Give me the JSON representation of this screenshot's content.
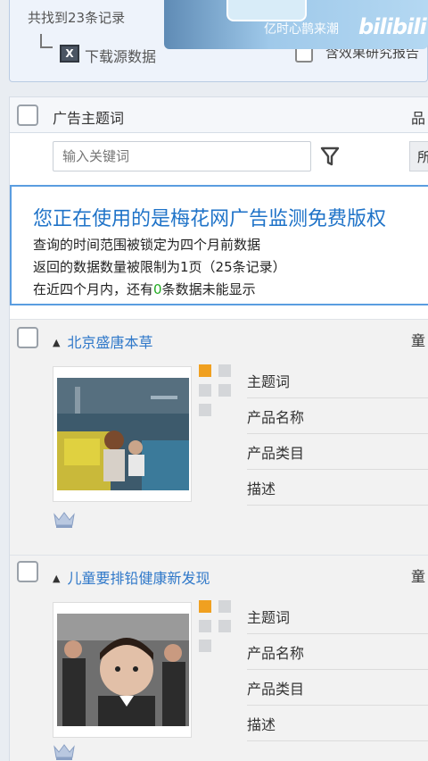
{
  "top": {
    "found_text": "共找到23条记录",
    "download_label": "下载源数据",
    "download_icon": "excel-icon",
    "checkbox_label": "含效果研究报告"
  },
  "video_overlay": {
    "watermark_text": "亿时心鹊来潮",
    "platform_logo": "bilibili"
  },
  "table": {
    "header_title": "广告主题词",
    "header_right": "品",
    "search_placeholder": "输入关键词",
    "select_value": "所"
  },
  "notice": {
    "title": "您正在使用的是梅花网广告监测免费版权",
    "line1": "查询的时间范围被锁定为四个月前数据",
    "line2": "返回的数据数量被限制为1页（25条记录）",
    "line3_pre": "在近四个月内，还有",
    "line3_count": "0",
    "line3_post": "条数据未能显示"
  },
  "records": [
    {
      "title": "北京盛唐本草",
      "right": "童",
      "fields": [
        "主题词",
        "产品名称",
        "产品类目",
        "描述"
      ]
    },
    {
      "title": "儿童要排铅健康新发现",
      "right": "童",
      "fields": [
        "主题词",
        "产品名称",
        "产品类目",
        "描述"
      ]
    }
  ],
  "colors": {
    "accent": "#2f78c9",
    "notice_border": "#5a9de0",
    "highlight_orange": "#f0a020",
    "zero_green": "#22aa22"
  }
}
